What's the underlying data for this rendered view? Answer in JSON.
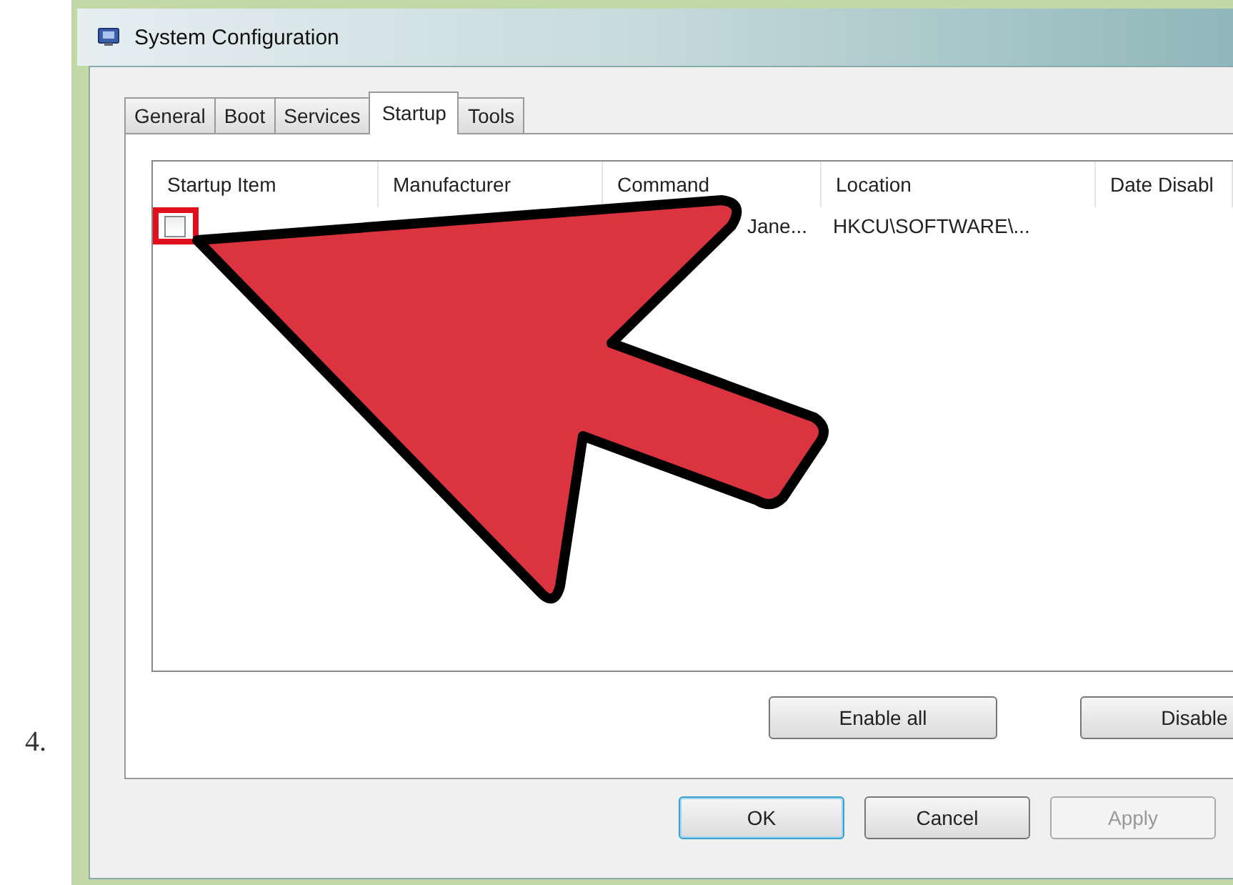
{
  "step_number": "4.",
  "window": {
    "title": "System Configuration"
  },
  "tabs": [
    {
      "label": "General",
      "selected": false
    },
    {
      "label": "Boot",
      "selected": false
    },
    {
      "label": "Services",
      "selected": false
    },
    {
      "label": "Startup",
      "selected": true
    },
    {
      "label": "Tools",
      "selected": false
    }
  ],
  "table": {
    "columns": [
      "Startup Item",
      "Manufacturer",
      "Command",
      "Location",
      "Date Disabl"
    ],
    "rows": [
      {
        "checked": false,
        "highlighted": true,
        "command": "Jane...",
        "location": "HKCU\\SOFTWARE\\..."
      }
    ]
  },
  "panel_buttons": [
    "Enable all",
    "Disable"
  ],
  "dialog_buttons": [
    {
      "label": "OK",
      "default": true,
      "disabled": false
    },
    {
      "label": "Cancel",
      "default": false,
      "disabled": false
    },
    {
      "label": "Apply",
      "default": false,
      "disabled": true
    }
  ]
}
